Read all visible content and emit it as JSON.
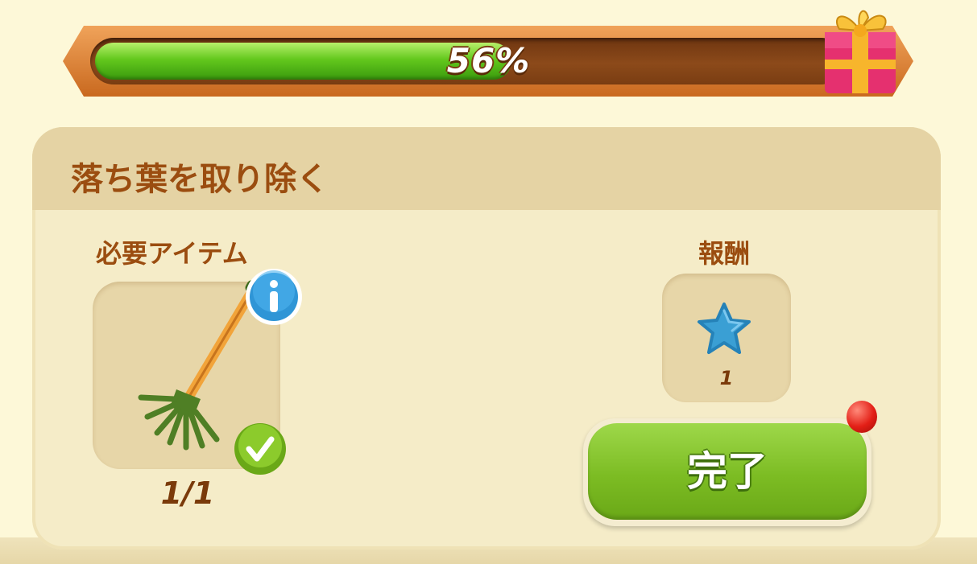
{
  "progress": {
    "label": "56%",
    "value": 0.56,
    "reward_icon": "gift-icon"
  },
  "task": {
    "title": "落ち葉を取り除く",
    "required_items_label": "必要アイテム",
    "required_item": {
      "icon": "rake-icon",
      "count": "1/1",
      "info_icon": "info-icon",
      "status_icon": "check-icon"
    },
    "reward_label": "報酬",
    "reward": {
      "icon": "star-icon",
      "count": "1"
    },
    "complete_button_label": "完了",
    "notification": "red-dot"
  },
  "colors": {
    "title_brown": "#9b4d10",
    "progress_green": "#63c81d",
    "button_green": "#7cbc23",
    "panel_bg": "#f5ecc8",
    "page_bg": "#fdf8d8"
  }
}
